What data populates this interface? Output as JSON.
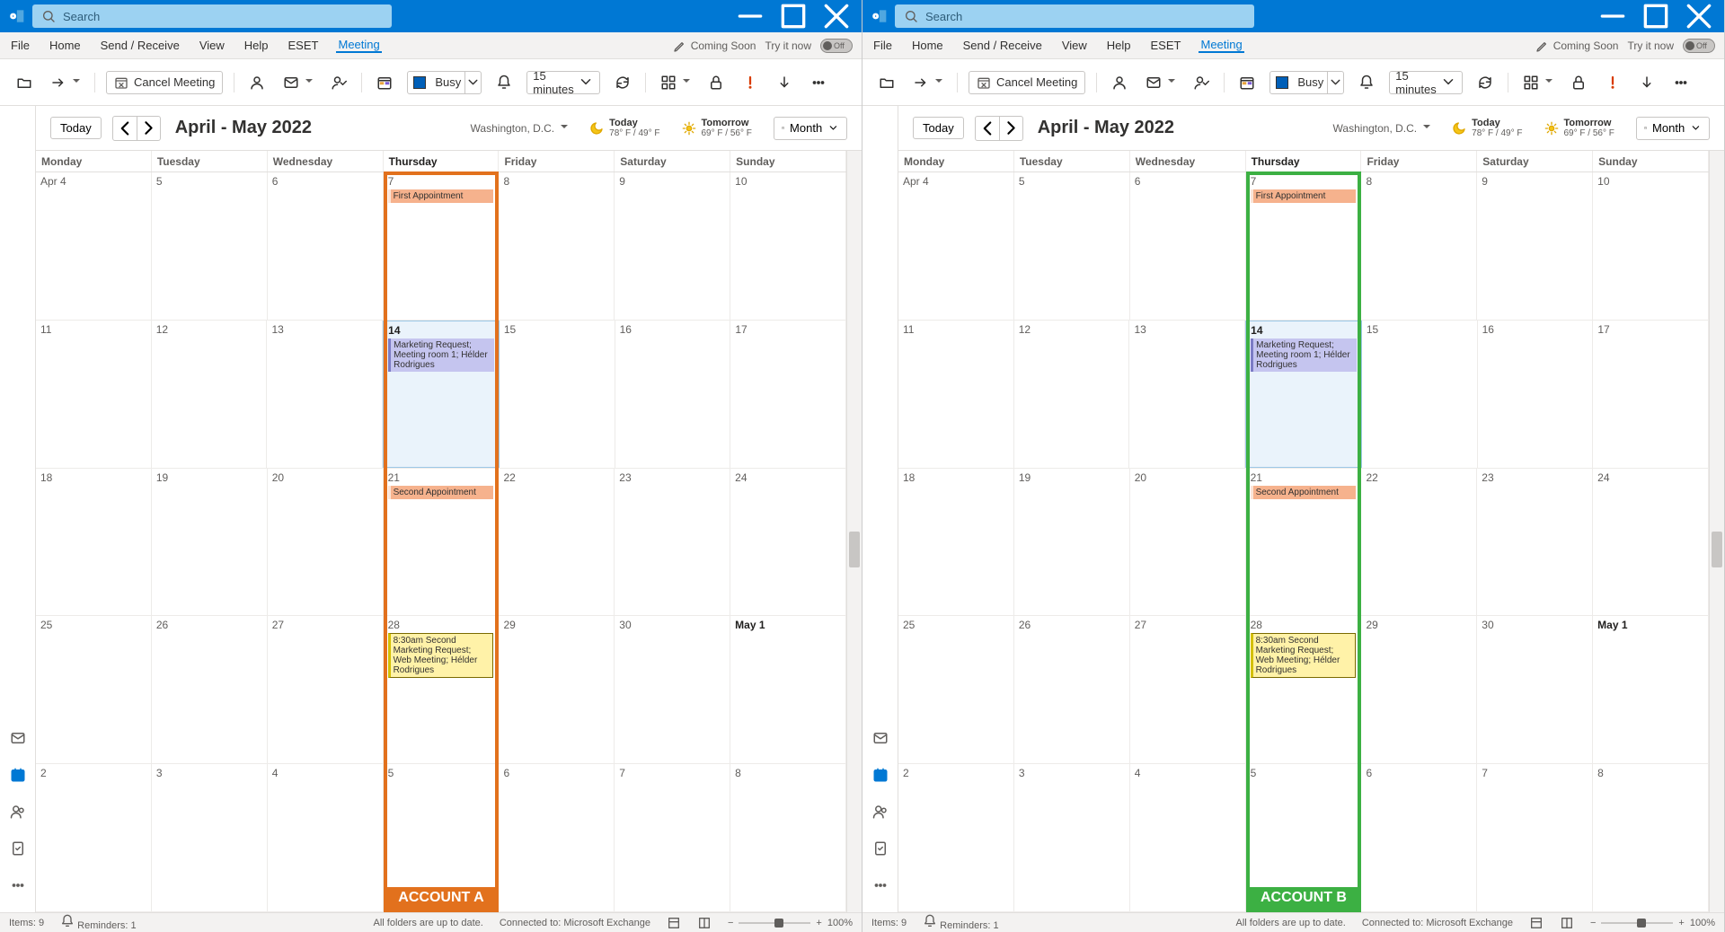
{
  "panes": [
    {
      "highlight": {
        "label": "ACCOUNT A",
        "color": "orange"
      }
    },
    {
      "highlight": {
        "label": "ACCOUNT B",
        "color": "green"
      }
    }
  ],
  "search": {
    "placeholder": "Search"
  },
  "menus": [
    "File",
    "Home",
    "Send / Receive",
    "View",
    "Help",
    "ESET",
    "Meeting"
  ],
  "active_menu": "Meeting",
  "coming_soon": "Coming Soon",
  "try_it_now": "Try it now",
  "toggle_off": "Off",
  "ribbon": {
    "cancel_meeting": "Cancel Meeting",
    "busy": "Busy",
    "reminder": "15 minutes"
  },
  "cal": {
    "today_btn": "Today",
    "range": "April - May 2022",
    "location": "Washington, D.C.",
    "today_label": "Today",
    "today_temp": "78° F / 49° F",
    "tomorrow_label": "Tomorrow",
    "tomorrow_temp": "69° F / 56° F",
    "view": "Month",
    "days": [
      "Monday",
      "Tuesday",
      "Wednesday",
      "Thursday",
      "Friday",
      "Saturday",
      "Sunday"
    ],
    "bold_day_index": 3,
    "weeks": [
      {
        "cells": [
          {
            "date": "Apr 4"
          },
          {
            "date": "5"
          },
          {
            "date": "6"
          },
          {
            "date": "7",
            "events": [
              {
                "cls": "ev-orange",
                "text": "First Appointment"
              }
            ]
          },
          {
            "date": "8"
          },
          {
            "date": "9"
          },
          {
            "date": "10"
          }
        ]
      },
      {
        "cells": [
          {
            "date": "11"
          },
          {
            "date": "12"
          },
          {
            "date": "13"
          },
          {
            "date": "14",
            "today": true,
            "bold": true,
            "events": [
              {
                "cls": "ev-purple",
                "text": "Marketing Request; Meeting room 1; Hélder Rodrigues"
              }
            ]
          },
          {
            "date": "15"
          },
          {
            "date": "16"
          },
          {
            "date": "17"
          }
        ]
      },
      {
        "cells": [
          {
            "date": "18"
          },
          {
            "date": "19"
          },
          {
            "date": "20"
          },
          {
            "date": "21",
            "events": [
              {
                "cls": "ev-orange",
                "text": "Second Appointment"
              }
            ]
          },
          {
            "date": "22"
          },
          {
            "date": "23"
          },
          {
            "date": "24"
          }
        ]
      },
      {
        "cells": [
          {
            "date": "25"
          },
          {
            "date": "26"
          },
          {
            "date": "27"
          },
          {
            "date": "28",
            "events": [
              {
                "cls": "ev-yellow",
                "text": "8:30am Second Marketing Request; Web Meeting; Hélder Rodrigues"
              }
            ]
          },
          {
            "date": "29"
          },
          {
            "date": "30"
          },
          {
            "date": "May 1",
            "bold": true
          }
        ]
      },
      {
        "cells": [
          {
            "date": "2"
          },
          {
            "date": "3"
          },
          {
            "date": "4"
          },
          {
            "date": "5"
          },
          {
            "date": "6"
          },
          {
            "date": "7"
          },
          {
            "date": "8"
          }
        ]
      }
    ]
  },
  "status": {
    "items": "Items: 9",
    "reminders": "Reminders: 1",
    "sync": "All folders are up to date.",
    "conn": "Connected to: Microsoft Exchange",
    "zoom": "100%"
  }
}
